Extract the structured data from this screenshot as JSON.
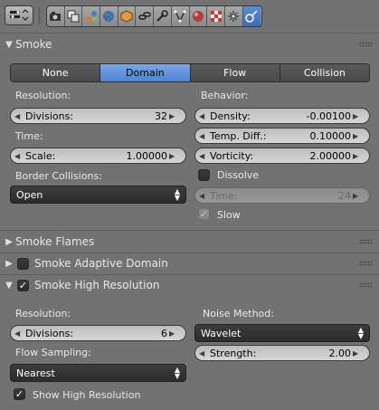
{
  "tabs": {
    "items": [
      "None",
      "Domain",
      "Flow",
      "Collision"
    ],
    "selected": "Domain"
  },
  "smoke_panel": {
    "title": "Smoke",
    "resolution_label": "Resolution:",
    "divisions_label": "Divisions:",
    "divisions_value": "32",
    "time_label": "Time:",
    "scale_label": "Scale:",
    "scale_value": "1.00000",
    "border_collisions_label": "Border Collisions:",
    "border_collisions_value": "Open",
    "behavior_label": "Behavior:",
    "density_label": "Density:",
    "density_value": "-0.00100",
    "temp_diff_label": "Temp. Diff.:",
    "temp_diff_value": "0.10000",
    "vorticity_label": "Vorticity:",
    "vorticity_value": "2.00000",
    "dissolve_label": "Dissolve",
    "dissolve_checked": false,
    "dissolve_time_label": "Time:",
    "dissolve_time_value": "24",
    "slow_label": "Slow",
    "slow_checked": true
  },
  "smoke_flames_panel": {
    "title": "Smoke Flames",
    "expanded": false
  },
  "adaptive_panel": {
    "title": "Smoke Adaptive Domain",
    "expanded": false,
    "enabled": false
  },
  "highres_panel": {
    "title": "Smoke High Resolution",
    "expanded": true,
    "enabled": true,
    "resolution_label": "Resolution:",
    "divisions_label": "Divisions:",
    "divisions_value": "6",
    "flow_sampling_label": "Flow Sampling:",
    "flow_sampling_value": "Nearest",
    "noise_method_label": "Noise Method:",
    "noise_method_value": "Wavelet",
    "strength_label": "Strength:",
    "strength_value": "2.00",
    "show_high_res_label": "Show High Resolution",
    "show_high_res_checked": true
  },
  "icons": {
    "editor_type": "properties-editor-icon",
    "toolbar": [
      "render-icon",
      "render-layers-icon",
      "scene-icon",
      "world-icon",
      "object-icon",
      "constraints-icon",
      "modifiers-icon",
      "data-icon",
      "material-icon",
      "texture-icon",
      "particles-icon",
      "physics-icon"
    ],
    "active_tool": "physics-icon"
  },
  "colors": {
    "panel_bg": "#727272",
    "selected_tab": "#5b8fdd",
    "field_bg": "#c9c9c9",
    "dropdown_bg": "#333333"
  }
}
